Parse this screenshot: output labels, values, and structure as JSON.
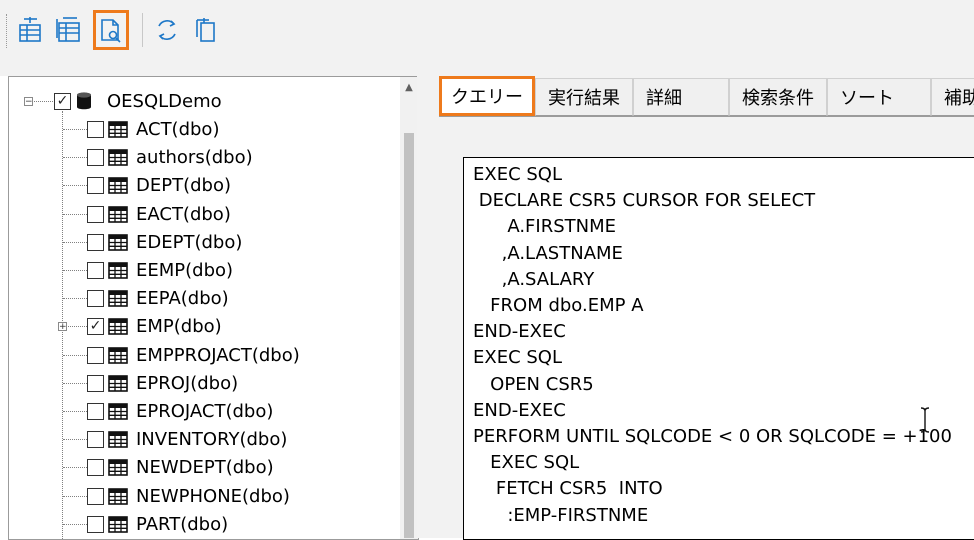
{
  "toolbar": {
    "buttons": [
      {
        "name": "generate-icon"
      },
      {
        "name": "generate-all-icon"
      },
      {
        "name": "preview-icon",
        "highlighted": true
      },
      {
        "name": "refresh-icon"
      },
      {
        "name": "copy-icon"
      }
    ]
  },
  "tree": {
    "root": {
      "label": "OESQLDemo",
      "checked": true,
      "expanded": true
    },
    "items": [
      {
        "label": "ACT(dbo)",
        "checked": false,
        "expandable": false
      },
      {
        "label": "authors(dbo)",
        "checked": false,
        "expandable": false
      },
      {
        "label": "DEPT(dbo)",
        "checked": false,
        "expandable": false
      },
      {
        "label": "EACT(dbo)",
        "checked": false,
        "expandable": false
      },
      {
        "label": "EDEPT(dbo)",
        "checked": false,
        "expandable": false
      },
      {
        "label": "EEMP(dbo)",
        "checked": false,
        "expandable": false
      },
      {
        "label": "EEPA(dbo)",
        "checked": false,
        "expandable": false
      },
      {
        "label": "EMP(dbo)",
        "checked": true,
        "expandable": true
      },
      {
        "label": "EMPPROJACT(dbo)",
        "checked": false,
        "expandable": false
      },
      {
        "label": "EPROJ(dbo)",
        "checked": false,
        "expandable": false
      },
      {
        "label": "EPROJACT(dbo)",
        "checked": false,
        "expandable": false
      },
      {
        "label": "INVENTORY(dbo)",
        "checked": false,
        "expandable": false
      },
      {
        "label": "NEWDEPT(dbo)",
        "checked": false,
        "expandable": false
      },
      {
        "label": "NEWPHONE(dbo)",
        "checked": false,
        "expandable": false
      },
      {
        "label": "PART(dbo)",
        "checked": false,
        "expandable": false
      }
    ]
  },
  "tabs": [
    {
      "label": "クエリー",
      "active": true
    },
    {
      "label": "実行結果"
    },
    {
      "label": "詳細"
    },
    {
      "label": "検索条件"
    },
    {
      "label": "ソート"
    },
    {
      "label": "補助コ"
    }
  ],
  "query": {
    "lines": [
      "EXEC SQL",
      " DECLARE CSR5 CURSOR FOR SELECT",
      "      A.FIRSTNME",
      "     ,A.LASTNAME",
      "     ,A.SALARY",
      "   FROM dbo.EMP A",
      "END-EXEC",
      "EXEC SQL",
      "   OPEN CSR5",
      "END-EXEC",
      "PERFORM UNTIL SQLCODE < 0 OR SQLCODE = +100",
      "   EXEC SQL",
      "    FETCH CSR5  INTO",
      "      :EMP-FIRSTNME"
    ]
  },
  "colors": {
    "highlight": "#ee7a1c",
    "icon_blue": "#1e78c8"
  }
}
